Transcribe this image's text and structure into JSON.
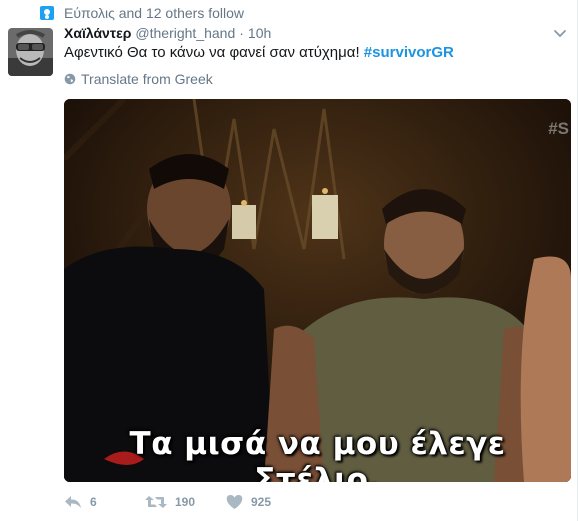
{
  "context": {
    "icon": "person-icon",
    "text": "Εύπολις and 12 others follow"
  },
  "author": {
    "fullname": "Χαϊλάντερ",
    "handle": "@theright_hand",
    "separator": "·",
    "time": "10h"
  },
  "tweet": {
    "text": "Αφεντικό Θα το κάνω να φανεί σαν ατύχημα! ",
    "hashtag": "#survivorGR"
  },
  "translate": {
    "icon": "globe-icon",
    "label": "Translate from Greek"
  },
  "media": {
    "caption": "Τα μισά να μου έλεγε Στέλιο.",
    "watermark": "#S"
  },
  "actions": {
    "reply_count": "6",
    "retweet_count": "190",
    "like_count": "925"
  },
  "colors": {
    "accent": "#1b95e0",
    "muted": "#657786",
    "action": "#8899a6"
  }
}
